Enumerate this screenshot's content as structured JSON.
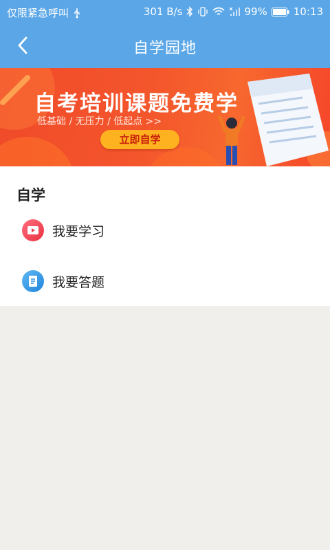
{
  "status_bar": {
    "carrier": "仅限紧急呼叫",
    "speed": "301 B/s",
    "battery": "99%",
    "time": "10:13"
  },
  "nav": {
    "title": "自学园地",
    "back_icon": "chevron-left-icon"
  },
  "banner": {
    "headline": "自考培训课题免费学",
    "subline": "低基础 / 无压力 / 低起点 >>",
    "button_label": "立即自学"
  },
  "section": {
    "title": "自学",
    "items": [
      {
        "label": "我要学习",
        "icon": "video-play-icon",
        "color": "#f2405a"
      },
      {
        "label": "我要答题",
        "icon": "document-edit-icon",
        "color": "#2f93e4"
      }
    ]
  },
  "colors": {
    "primary": "#5aa6e7",
    "banner_red": "#f24b2b",
    "banner_button": "#ffb21f"
  }
}
